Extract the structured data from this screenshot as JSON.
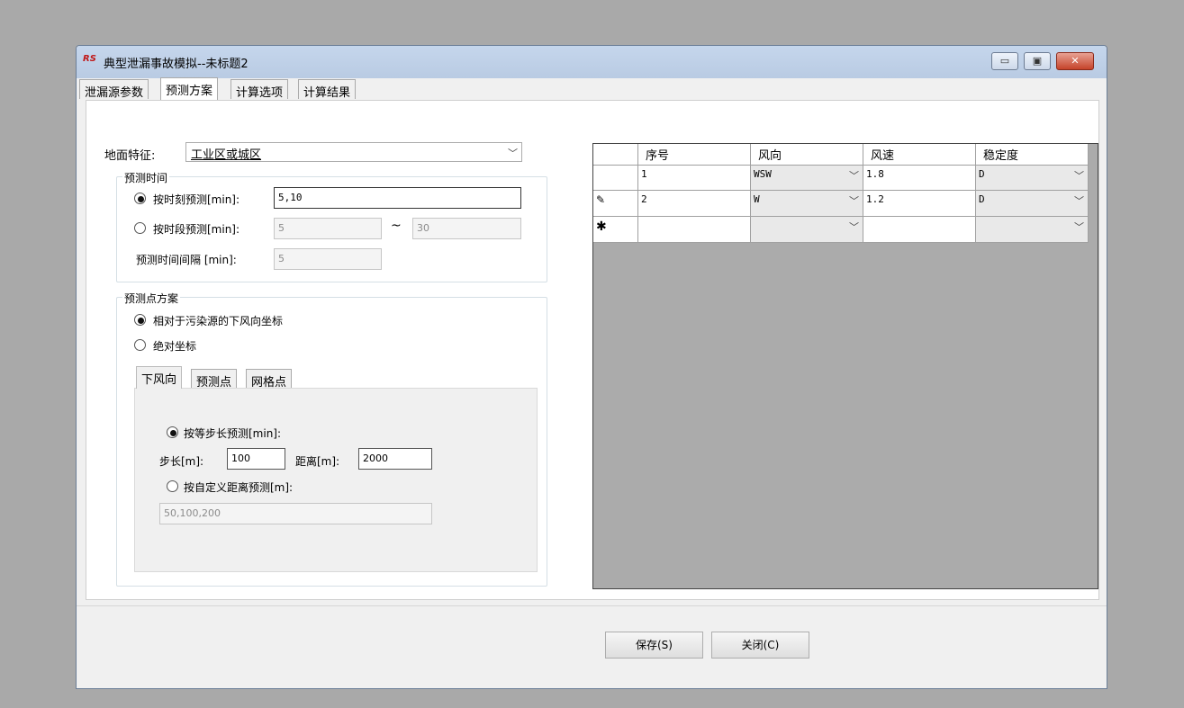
{
  "window": {
    "title": "典型泄漏事故模拟--未标题2",
    "icon_text": "RS",
    "controls": [
      "▭",
      "▣",
      "✕"
    ]
  },
  "tabs": [
    "泄漏源参数",
    "预测方案",
    "计算选项",
    "计算结果"
  ],
  "active_tab": "预测方案",
  "ground": {
    "label": "地面特征:",
    "value": "工业区或城区"
  },
  "prediction_time": {
    "group_title": "预测时间",
    "by_moment": {
      "label": "按时刻预测[min]:",
      "value": "5,10",
      "selected": true
    },
    "by_period": {
      "label": "按时段预测[min]:",
      "from": "5",
      "tilde": "~",
      "to": "30",
      "selected": false
    },
    "interval": {
      "label": "预测时间间隔 [min]:",
      "value": "5"
    }
  },
  "point_scheme": {
    "group_title": "预测点方案",
    "relative": {
      "label": "相对于污染源的下风向坐标",
      "selected": true
    },
    "absolute": {
      "label": "绝对坐标",
      "selected": false
    },
    "subtabs": [
      "下风向",
      "预测点",
      "网格点"
    ],
    "active_subtab": "下风向",
    "equal_step": {
      "label": "按等步长预测[min]:",
      "selected": true
    },
    "step": {
      "label": "步长[m]:",
      "value": "100"
    },
    "distance": {
      "label": "距离[m]:",
      "value": "2000"
    },
    "custom": {
      "label": "按自定义距离预测[m]:",
      "value": "50,100,200",
      "selected": false
    }
  },
  "grid": {
    "headers": [
      "序号",
      "风向",
      "风速",
      "稳定度"
    ],
    "rows": [
      {
        "indicator": "",
        "no": "1",
        "dir": "WSW",
        "speed": "1.8",
        "stab": "D"
      },
      {
        "indicator": "✎",
        "no": "2",
        "dir": "W",
        "speed": "1.2",
        "stab": "D"
      },
      {
        "indicator": "✱",
        "no": "",
        "dir": "",
        "speed": "",
        "stab": ""
      }
    ]
  },
  "buttons": {
    "save": "保存(S)",
    "close": "关闭(C)"
  }
}
